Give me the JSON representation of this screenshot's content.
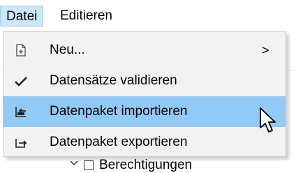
{
  "menubar": {
    "file": "Datei",
    "edit": "Editieren"
  },
  "menu": {
    "items": [
      {
        "label": "Neu...",
        "icon": "new-file-icon",
        "submenu_arrow": ">"
      },
      {
        "label": "Datensätze validieren",
        "icon": "checkmark-icon"
      },
      {
        "label": "Datenpaket importieren",
        "icon": "import-icon",
        "highlighted": true
      },
      {
        "label": "Datenpaket exportieren",
        "icon": "export-icon"
      }
    ]
  },
  "background": {
    "partial_label": "Berechtigungen"
  },
  "colors": {
    "highlight": "#91c9f7",
    "menubar_active": "#cce8ff",
    "menu_background": "#f2f2f2"
  }
}
